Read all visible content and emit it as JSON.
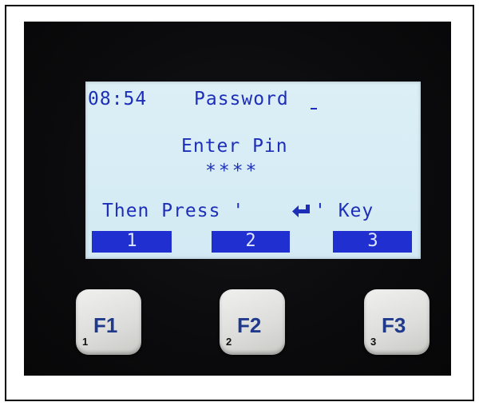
{
  "lcd": {
    "time": "08:54",
    "mode": "Password",
    "prompt": "Enter Pin",
    "pin_mask": "****",
    "instruction_before": "Then Press '",
    "instruction_after": "' Key"
  },
  "softkeys": [
    "1",
    "2",
    "3"
  ],
  "function_keys": [
    {
      "label": "F1",
      "number": "1"
    },
    {
      "label": "F2",
      "number": "2"
    },
    {
      "label": "F3",
      "number": "3"
    }
  ],
  "icons": {
    "enter_key": "enter-return-arrow-icon"
  },
  "colors": {
    "lcd_text": "#1d2fb8",
    "lcd_background": "#d8edf5",
    "softkey_bar": "#1f2fd0",
    "key_label": "#1f3a8c"
  }
}
